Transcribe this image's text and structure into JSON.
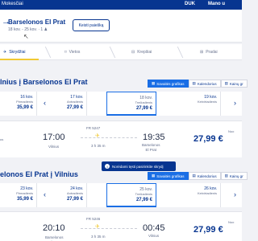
{
  "topbar": {
    "title": "Mokesčiai",
    "currency": "DUK",
    "account": "Mano u"
  },
  "route": {
    "name": "Barselonos El Prat",
    "meta": "18 kov. - 25 kov.  ·  1 ♟",
    "change_button": "Keisti paiešką"
  },
  "steps": [
    {
      "label": "Skrydžiai",
      "icon": "plane-icon"
    },
    {
      "label": "Vietos",
      "icon": "seat-icon"
    },
    {
      "label": "Krepšiai",
      "icon": "bag-icon"
    },
    {
      "label": "Pradai",
      "icon": "extras-icon"
    }
  ],
  "outbound": {
    "title": "lnius į Barselonos El Prat",
    "views": [
      "Savaitės grafikas",
      "Kalendorius",
      "Kainų gr"
    ],
    "dates": [
      {
        "date": "16 kov.",
        "weekday": "Pirmadienis",
        "price": "35,99 €"
      },
      {
        "date": "17 kov.",
        "weekday": "Antradienis",
        "price": "27,99 €"
      },
      {
        "date": "18 kov.",
        "weekday": "Trečiadienis",
        "price": "27,99 €"
      },
      {
        "date": "19 kov.",
        "weekday": "Ketvirtadienis",
        "price": ""
      }
    ],
    "flight": {
      "stub": "us",
      "dep_time": "17:00",
      "dep_city": "Vilnius",
      "number": "FR 5247",
      "duration": "3 h 35 m",
      "arr_time": "19:35",
      "arr_city": "Barselonos\nEl Prat",
      "from_label": "Nuo",
      "price": "27,99 €"
    }
  },
  "toast": {
    "text": "Norėdami tęsti pasirinkite skrydį"
  },
  "inbound": {
    "title": "elonos El Prat į Vilnius",
    "views": [
      "Savaitės grafikas",
      "Kalendorius",
      "Kainų gr"
    ],
    "dates": [
      {
        "date": "23 kov.",
        "weekday": "Pirmadienis",
        "price": "35,99 €"
      },
      {
        "date": "24 kov.",
        "weekday": "Antradienis",
        "price": "27,99 €"
      },
      {
        "date": "25 kov.",
        "weekday": "Trečiadienis",
        "price": "27,99 €"
      },
      {
        "date": "26 kov.",
        "weekday": "Ketvirtadienis",
        "price": ""
      }
    ],
    "flight": {
      "dep_time": "20:10",
      "dep_city": "Barselonos\nEl Prat",
      "number": "FR 5246",
      "duration": "3 h 35 m",
      "arr_time": "00:45",
      "arr_city": "Vilnius",
      "from_label": "Nuo",
      "price": "27,99 €"
    }
  }
}
